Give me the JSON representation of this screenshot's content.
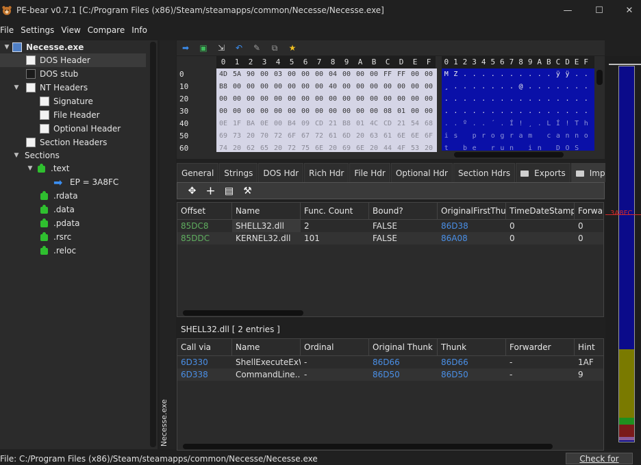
{
  "window": {
    "title": "PE-bear v0.7.1 [C:/Program Files (x86)/Steam/steamapps/common/Necesse/Necesse.exe]",
    "min_glyph": "—",
    "max_glyph": "☐",
    "close_glyph": "✕"
  },
  "menu": [
    "File",
    "Settings",
    "View",
    "Compare",
    "Info"
  ],
  "tree": {
    "root": "Necesse.exe",
    "dos_header": "DOS Header",
    "dos_stub": "DOS stub",
    "nt_headers": "NT Headers",
    "signature": "Signature",
    "file_header": "File Header",
    "optional_header": "Optional Header",
    "section_headers": "Section Headers",
    "sections": "Sections",
    "text": ".text",
    "ep": "EP = 3A8FC",
    "rdata": ".rdata",
    "data": ".data",
    "pdata": ".pdata",
    "rsrc": ".rsrc",
    "reloc": ".reloc"
  },
  "vertical_tab": "Necesse.exe",
  "toolbar_icons": [
    "arrow-right-icon",
    "image-icon",
    "export-icon",
    "undo-icon",
    "pin-icon",
    "copy-icon",
    "star-icon"
  ],
  "hex": {
    "columns": [
      "0",
      "1",
      "2",
      "3",
      "4",
      "5",
      "6",
      "7",
      "8",
      "9",
      "A",
      "B",
      "C",
      "D",
      "E",
      "F"
    ],
    "offsets": [
      "0",
      "10",
      "20",
      "30",
      "40",
      "50",
      "60"
    ],
    "rows": [
      [
        "4D",
        "5A",
        "90",
        "00",
        "03",
        "00",
        "00",
        "00",
        "04",
        "00",
        "00",
        "00",
        "FF",
        "FF",
        "00",
        "00"
      ],
      [
        "B8",
        "00",
        "00",
        "00",
        "00",
        "00",
        "00",
        "00",
        "40",
        "00",
        "00",
        "00",
        "00",
        "00",
        "00",
        "00"
      ],
      [
        "00",
        "00",
        "00",
        "00",
        "00",
        "00",
        "00",
        "00",
        "00",
        "00",
        "00",
        "00",
        "00",
        "00",
        "00",
        "00"
      ],
      [
        "00",
        "00",
        "00",
        "00",
        "00",
        "00",
        "00",
        "00",
        "00",
        "00",
        "00",
        "00",
        "08",
        "01",
        "00",
        "00"
      ],
      [
        "0E",
        "1F",
        "BA",
        "0E",
        "00",
        "B4",
        "09",
        "CD",
        "21",
        "B8",
        "01",
        "4C",
        "CD",
        "21",
        "54",
        "68"
      ],
      [
        "69",
        "73",
        "20",
        "70",
        "72",
        "6F",
        "67",
        "72",
        "61",
        "6D",
        "20",
        "63",
        "61",
        "6E",
        "6E",
        "6F"
      ],
      [
        "74",
        "20",
        "62",
        "65",
        "20",
        "72",
        "75",
        "6E",
        "20",
        "69",
        "6E",
        "20",
        "44",
        "4F",
        "53",
        "20"
      ]
    ],
    "ascii": [
      [
        "M",
        "Z",
        ".",
        ".",
        ".",
        ".",
        ".",
        ".",
        ".",
        ".",
        ".",
        ".",
        "ÿ",
        "ÿ",
        ".",
        "."
      ],
      [
        "¸",
        ".",
        ".",
        ".",
        ".",
        ".",
        ".",
        ".",
        "@",
        ".",
        ".",
        ".",
        ".",
        ".",
        ".",
        "."
      ],
      [
        ".",
        ".",
        ".",
        ".",
        ".",
        ".",
        ".",
        ".",
        ".",
        ".",
        ".",
        ".",
        ".",
        ".",
        ".",
        "."
      ],
      [
        ".",
        ".",
        ".",
        ".",
        ".",
        ".",
        ".",
        ".",
        ".",
        ".",
        ".",
        ".",
        ".",
        ".",
        ".",
        "."
      ],
      [
        ".",
        ".",
        "º",
        ".",
        ".",
        "´",
        ".",
        "Í",
        "!",
        "¸",
        ".",
        "L",
        "Í",
        "!",
        "T",
        "h"
      ],
      [
        "i",
        "s",
        " ",
        "p",
        "r",
        "o",
        "g",
        "r",
        "a",
        "m",
        " ",
        "c",
        "a",
        "n",
        "n",
        "o"
      ],
      [
        "t",
        " ",
        "b",
        "e",
        " ",
        "r",
        "u",
        "n",
        " ",
        "i",
        "n",
        " ",
        "D",
        "O",
        "S",
        " "
      ]
    ]
  },
  "tabs": [
    "General",
    "Strings",
    "DOS Hdr",
    "Rich Hdr",
    "File Hdr",
    "Optional Hdr",
    "Section Hdrs",
    "Exports",
    "Imports"
  ],
  "tab_nav": {
    "left": "◀",
    "right": "▶"
  },
  "imports": {
    "columns": [
      "Offset",
      "Name",
      "Func. Count",
      "Bound?",
      "OriginalFirstThun",
      "TimeDateStamp",
      "Forwar"
    ],
    "rows": [
      [
        "85DC8",
        "SHELL32.dll",
        "2",
        "FALSE",
        "86D38",
        "0",
        "0"
      ],
      [
        "85DDC",
        "KERNEL32.dll",
        "101",
        "FALSE",
        "86A08",
        "0",
        "0"
      ]
    ]
  },
  "entries_label": "SHELL32.dll   [ 2 entries ]",
  "functions": {
    "columns": [
      "Call via",
      "Name",
      "Ordinal",
      "Original Thunk",
      "Thunk",
      "Forwarder",
      "Hint"
    ],
    "rows": [
      [
        "6D330",
        "ShellExecuteExW",
        "-",
        "86D66",
        "86D66",
        "-",
        "1AF"
      ],
      [
        "6D338",
        "CommandLine...",
        "-",
        "86D50",
        "86D50",
        "-",
        "9"
      ]
    ]
  },
  "overview": {
    "marker": "3A8FC",
    "colors": {
      "code": "#0b0b8a",
      "rdata": "#7a7a00",
      "data": "#1f8f1f",
      "reloc": "#7a1a1a",
      "rsrc": "#8a5a9a"
    }
  },
  "status": {
    "file": "File: C:/Program Files (x86)/Steam/steamapps/common/Necesse/Necesse.exe",
    "update": "Check for updates"
  }
}
